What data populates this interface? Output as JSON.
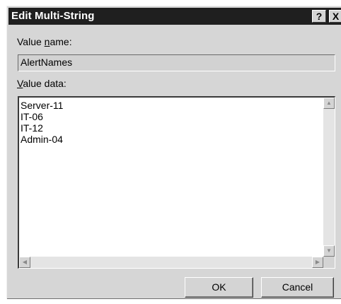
{
  "window": {
    "title": "Edit Multi-String",
    "help_glyph": "?",
    "close_glyph": "X"
  },
  "value_name": {
    "label_pre": "Value ",
    "label_mnemonic": "n",
    "label_post": "ame:",
    "value": "AlertNames"
  },
  "value_data": {
    "label_mnemonic": "V",
    "label_post": "alue data:",
    "lines": [
      "Server-11",
      "IT-06",
      "IT-12",
      "Admin-04"
    ]
  },
  "scrollbar_glyphs": {
    "up": "▲",
    "down": "▼",
    "left": "◀",
    "right": "▶"
  },
  "buttons": {
    "ok_label": "OK",
    "cancel_label": "Cancel"
  }
}
